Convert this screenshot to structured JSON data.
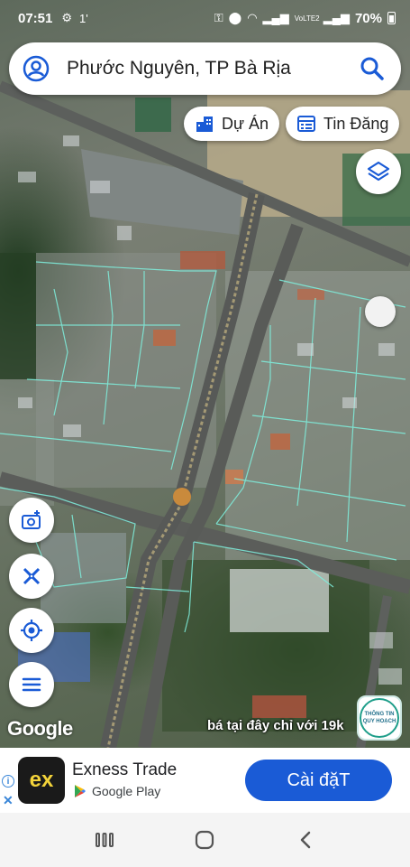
{
  "status_bar": {
    "time": "07:51",
    "extra": "1'",
    "network": "VoLTE2",
    "battery": "70%"
  },
  "search": {
    "query": "Phước Nguyên, TP Bà Rịa",
    "avatar_icon": "account-circle-icon",
    "search_icon": "search-icon"
  },
  "chips": {
    "du_an": "Dự Án",
    "tin_dang": "Tin Đăng"
  },
  "map": {
    "layers_icon": "layers-icon",
    "tools": [
      "camera-add-icon",
      "ruler-tool-icon",
      "my-location-icon",
      "menu-icon"
    ],
    "attribution": "Google",
    "promo_text": "bá tại đây chỉ với 19k",
    "badge_line1": "THÔNG TIN",
    "badge_line2": "QUY HOẠCH"
  },
  "ad": {
    "app_logo_text": "ex",
    "app_name": "Exness Trade",
    "store": "Google Play",
    "install_label": "Cài đặT",
    "accent_color": "#1a5bd6"
  },
  "nav": {
    "recent_icon": "recent-apps-icon",
    "home_icon": "home-icon",
    "back_icon": "back-icon"
  }
}
